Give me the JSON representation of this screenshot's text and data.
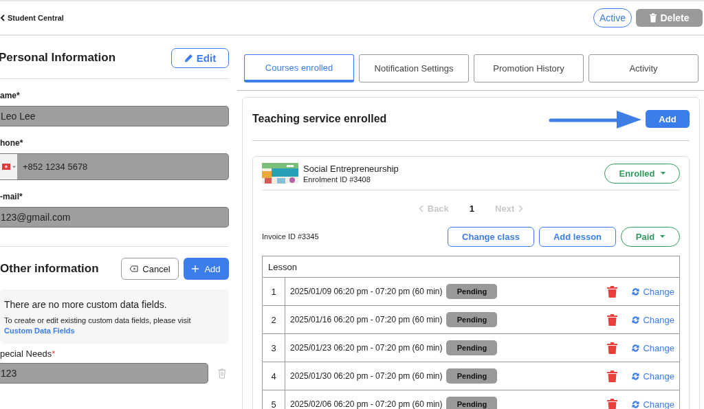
{
  "top_bar": {
    "back_label": "Student Central",
    "status_button": "Active",
    "delete_button": "Delete"
  },
  "personal": {
    "title": "Personal Information",
    "edit_button": "Edit",
    "fields": [
      {
        "kind": "text",
        "label": "ame*",
        "value": "Leo Lee"
      },
      {
        "kind": "phone",
        "label": "hone*",
        "value": "+852 1234 5678"
      },
      {
        "kind": "text",
        "label": "-mail*",
        "value": "123@gmail.com"
      }
    ]
  },
  "other": {
    "title": "Other information",
    "cancel_button": "Cancel",
    "add_button": "Add",
    "notice": "There are no more custom data fields.",
    "hint": "To create or edit existing custom data fields, please visit",
    "link": "Custom Data Fields",
    "custom_fields": [
      {
        "label": "pecial Needs",
        "required_mark": "*",
        "value": "123"
      }
    ]
  },
  "tabs": [
    {
      "label": "Courses enrolled",
      "selected": true
    },
    {
      "label": "Notification Settings",
      "selected": false
    },
    {
      "label": "Promotion History",
      "selected": false
    },
    {
      "label": "Activity",
      "selected": false
    }
  ],
  "service": {
    "title": "Teaching service enrolled",
    "add_button": "Add",
    "enrolment": {
      "course": "Social Entrepreneurship",
      "enrolment_id": "Enrolment ID #3408",
      "status": "Enrolled",
      "pagination": {
        "back": "Back",
        "back_disabled": true,
        "page": "1",
        "next": "Next",
        "next_disabled": true
      },
      "invoice": "Invoice ID #3345",
      "change_class": "Change class",
      "add_lesson": "Add lesson",
      "payment": "Paid",
      "table": {
        "header": "Lesson",
        "rows": [
          {
            "index": "1",
            "time": "2025/01/09 06:20 pm - 07:20 pm (60 min)",
            "status": "Pending",
            "action": "Change"
          },
          {
            "index": "2",
            "time": "2025/01/16 06:20 pm - 07:20 pm (60 min)",
            "status": "Pending",
            "action": "Change"
          },
          {
            "index": "3",
            "time": "2025/01/23 06:20 pm - 07:20 pm (60 min)",
            "status": "Pending",
            "action": "Change"
          },
          {
            "index": "4",
            "time": "2025/01/30 06:20 pm - 07:20 pm (60 min)",
            "status": "Pending",
            "action": "Change"
          },
          {
            "index": "5",
            "time": "2025/02/06 06:20 pm - 07:20 pm (60 min)",
            "status": "Pending",
            "action": "Change"
          }
        ]
      }
    }
  }
}
